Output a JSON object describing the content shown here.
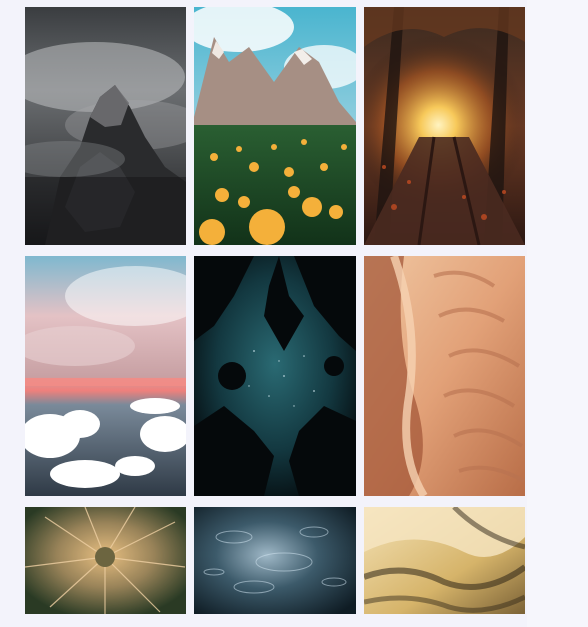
{
  "gallery": {
    "background": "#f3f3fb",
    "items": [
      {
        "subject": "mountain-peak-clouds",
        "palette": [
          "#2b2d30",
          "#5b5d60",
          "#8f9194",
          "#c8c9cb"
        ]
      },
      {
        "subject": "alpine-flower-meadow",
        "palette": [
          "#3aa9c6",
          "#b8a59a",
          "#1f4b2b",
          "#f4b03a"
        ]
      },
      {
        "subject": "autumn-forest-path",
        "palette": [
          "#2a1d17",
          "#7a3f22",
          "#c56a2c",
          "#f7d36b"
        ]
      },
      {
        "subject": "sky-above-clouds",
        "palette": [
          "#7fb3c9",
          "#d7a2a5",
          "#ffffff",
          "#3a4656"
        ]
      },
      {
        "subject": "night-forest-sky",
        "palette": [
          "#061014",
          "#16414a",
          "#2d6972",
          "#0c1b1f"
        ]
      },
      {
        "subject": "desert-sand-ripples",
        "palette": [
          "#b86d47",
          "#e7ad84",
          "#f0c7a2",
          "#7a3e2b"
        ]
      },
      {
        "subject": "dandelion-seed-head",
        "palette": [
          "#0f2a12",
          "#7a7348",
          "#e6c07b",
          "#f0b6b0"
        ]
      },
      {
        "subject": "rain-ripples-water",
        "palette": [
          "#0f1c24",
          "#2b4656",
          "#7f97a5",
          "#cfe2ee"
        ]
      },
      {
        "subject": "golden-sand-dunes",
        "palette": [
          "#2d2416",
          "#7b6236",
          "#d6b46a",
          "#f4e2b6"
        ]
      }
    ]
  }
}
